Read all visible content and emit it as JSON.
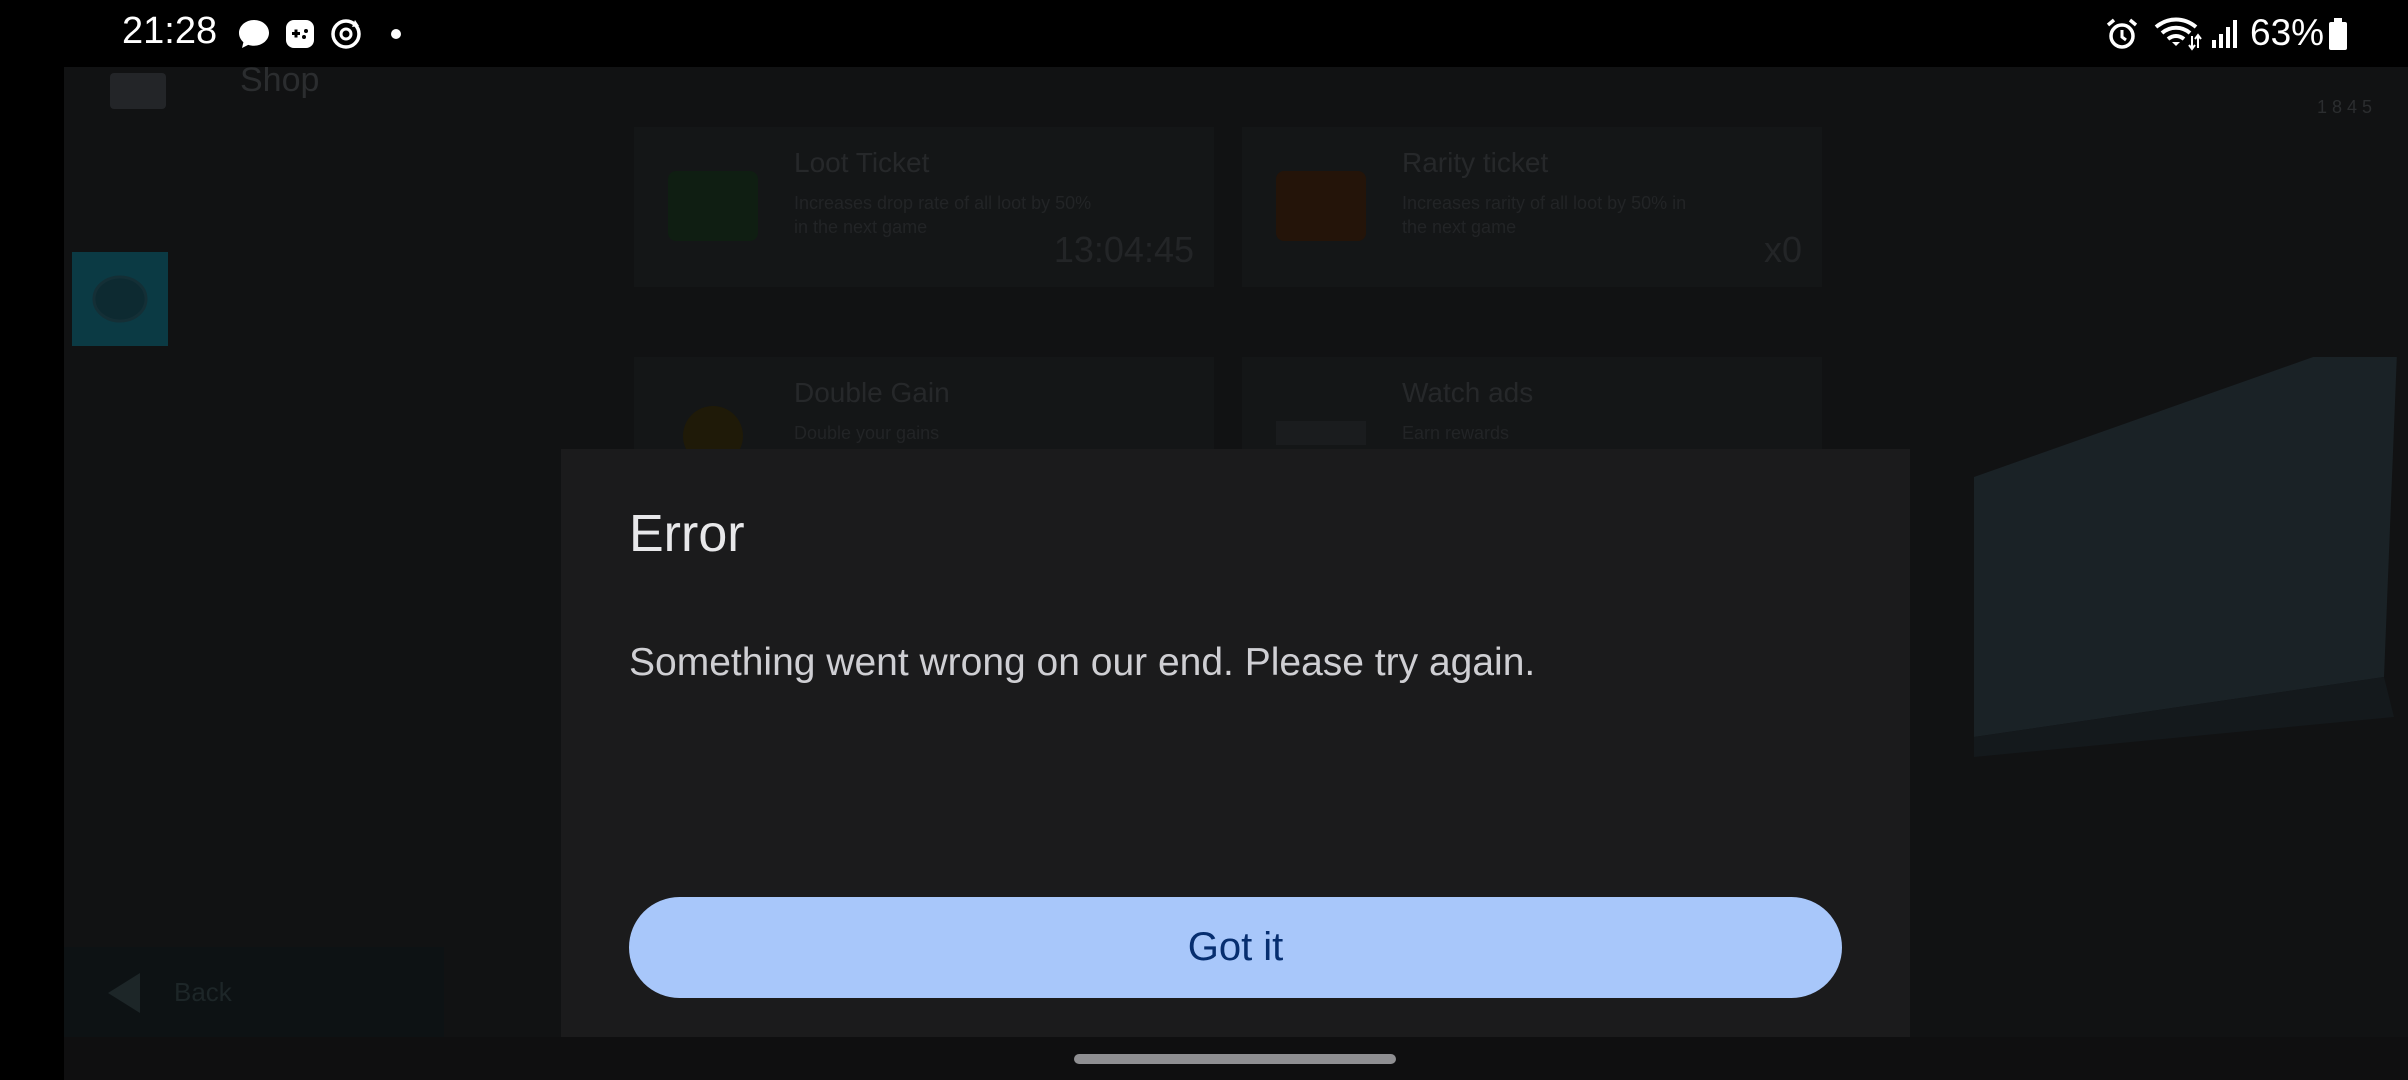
{
  "status_bar": {
    "time": "21:28",
    "left_icons": [
      "chat-bubble-icon",
      "game-controller-icon",
      "sync-icon",
      "dot-icon"
    ],
    "right_icons": [
      "alarm-icon",
      "wifi-icon",
      "signal-icon",
      "battery-icon"
    ],
    "battery_percent": "63%"
  },
  "game": {
    "header": {
      "title": "Shop",
      "coins": "1 8 4 5"
    },
    "cards": [
      {
        "title": "Loot Ticket",
        "desc": "Increases drop rate of all loot by 50% in the next game",
        "meta": "13:04:45"
      },
      {
        "title": "Rarity ticket",
        "desc": "Increases rarity of all loot by 50% in the next game",
        "meta": "x0"
      },
      {
        "title": "Double Gain",
        "desc": "Double your gains",
        "meta": ""
      },
      {
        "title": "Watch ads",
        "desc": "Earn rewards",
        "meta": ""
      }
    ],
    "back_label": "Back"
  },
  "dialog": {
    "title": "Error",
    "message": "Something went wrong on our end. Please try again.",
    "button_label": "Got it"
  },
  "colors": {
    "dialog_bg": "#1b1b1c",
    "button_bg": "#a8c7fa",
    "button_text": "#062e6f"
  }
}
